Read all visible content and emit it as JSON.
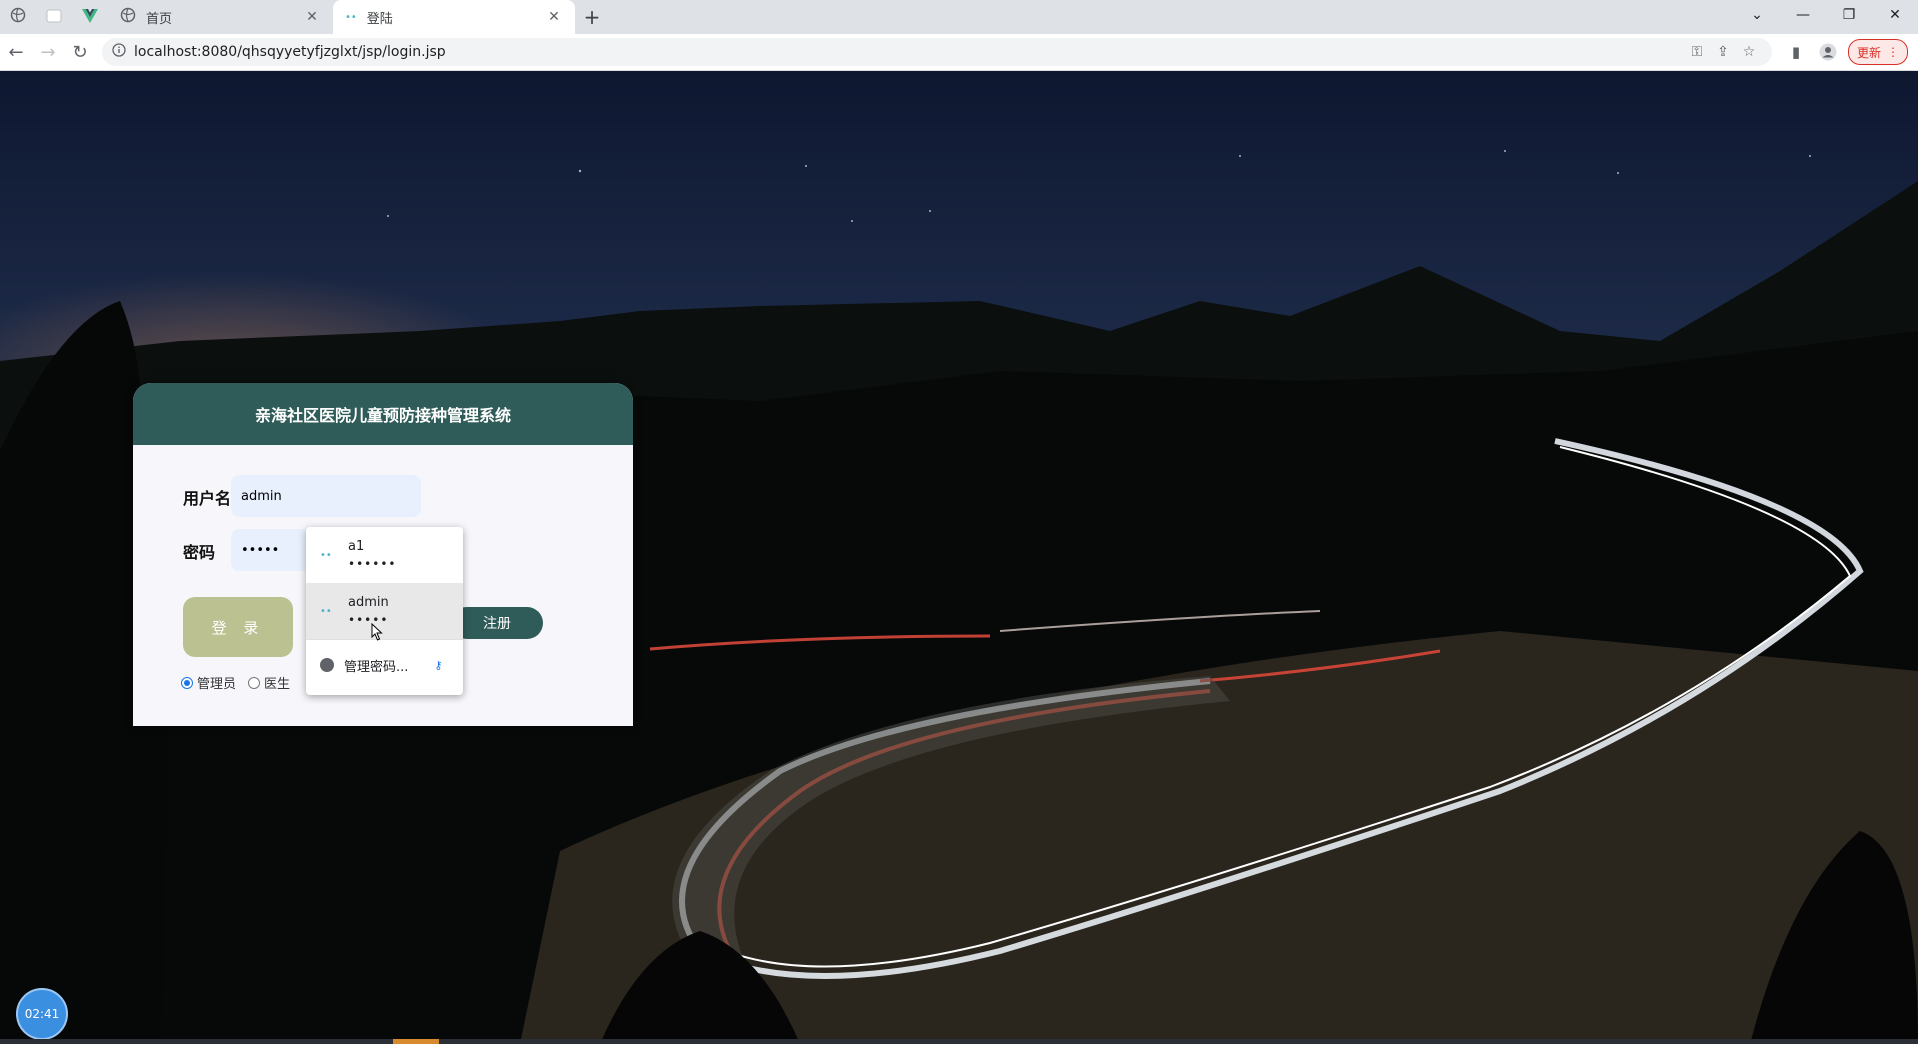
{
  "browser": {
    "tabs": [
      {
        "title": "首页",
        "active": false
      },
      {
        "title": "登陆",
        "active": true
      }
    ],
    "new_tab_label": "+",
    "url": "localhost:8080/qhsqyyetyfjzglxt/jsp/login.jsp",
    "update_label": "更新",
    "window_controls": [
      "chevron-down",
      "minimize",
      "restore",
      "close"
    ]
  },
  "login": {
    "title": "亲海社区医院儿童预防接种管理系统",
    "username_label": "用户名",
    "username_value": "admin",
    "password_label": "密码",
    "password_value": "•••••",
    "login_button": "登 录",
    "register_button": "注册",
    "roles": [
      {
        "label": "管理员",
        "checked": true
      },
      {
        "label": "医生",
        "checked": false
      }
    ]
  },
  "autofill": {
    "entries": [
      {
        "username": "a1",
        "password": "••••••"
      },
      {
        "username": "admin",
        "password": "•••••"
      }
    ],
    "manage_label": "管理密码..."
  },
  "overlay": {
    "clock": "02:41"
  },
  "colors": {
    "header_green": "#2f5c58",
    "login_button": "#bcc192",
    "input_bg": "#e8f0fe"
  }
}
